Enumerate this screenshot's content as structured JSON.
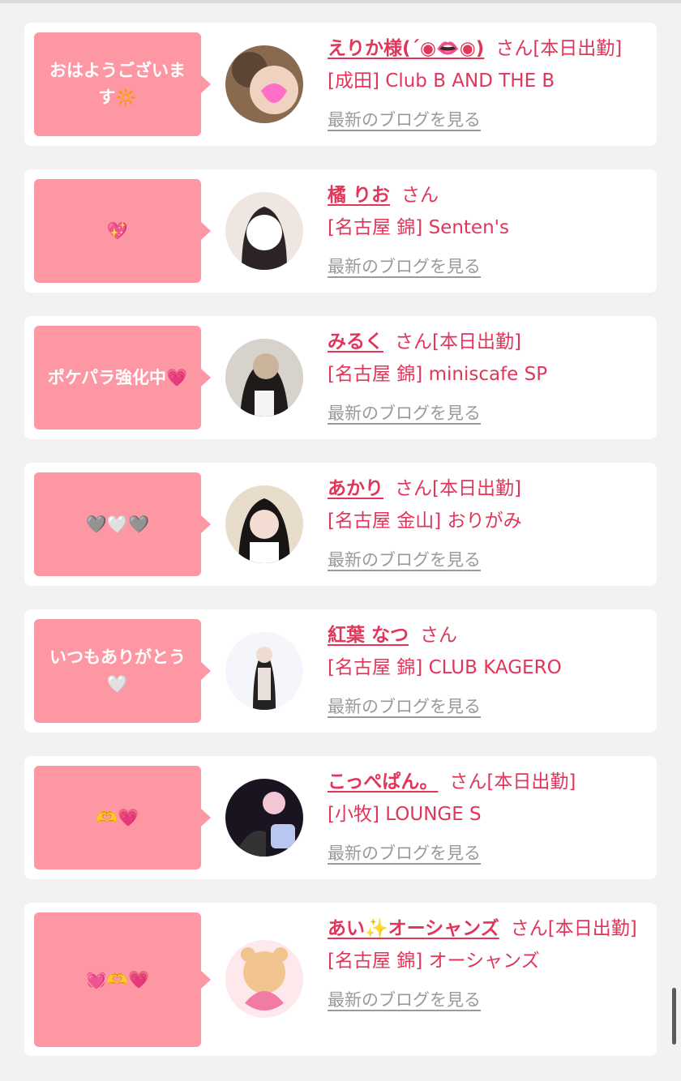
{
  "cards": [
    {
      "bubble": "おはようございます🔆",
      "name": "えりか様(´◉👄◉)",
      "san": "さん",
      "status": "[本日出勤]",
      "shop": "[成田] Club B AND THE B",
      "blog": "最新のブログを見る"
    },
    {
      "bubble": "💖",
      "name": "橘 りお",
      "san": "さん",
      "status": "",
      "shop": "[名古屋 錦] Senten's",
      "blog": "最新のブログを見る"
    },
    {
      "bubble": "ポケパラ強化中💗",
      "name": "みるく",
      "san": "さん",
      "status": "[本日出勤]",
      "shop": "[名古屋 錦] miniscafe SP",
      "blog": "最新のブログを見る"
    },
    {
      "bubble": "🩶🤍🩶",
      "name": "あかり",
      "san": "さん",
      "status": "[本日出勤]",
      "shop": "[名古屋 金山] おりがみ",
      "blog": "最新のブログを見る"
    },
    {
      "bubble": "いつもありがとう🤍",
      "name": "紅葉 なつ",
      "san": "さん",
      "status": "",
      "shop": "[名古屋 錦] CLUB KAGERO",
      "blog": "最新のブログを見る"
    },
    {
      "bubble": "🫶💗",
      "name": "こっぺぱん。",
      "san": "さん",
      "status": "[本日出勤]",
      "shop": "[小牧] LOUNGE S",
      "blog": "最新のブログを見る"
    },
    {
      "bubble": "💓🫶💗",
      "name": "あい✨オーシャンズ",
      "san": "さん",
      "status": "[本日出勤]",
      "shop": "[名古屋 錦] オーシャンズ",
      "blog": "最新のブログを見る"
    }
  ],
  "colors": {
    "accent": "#e0365a",
    "bubble": "#fe97a4",
    "link_gray": "#9a9a9a",
    "background": "#f2f2f2"
  }
}
